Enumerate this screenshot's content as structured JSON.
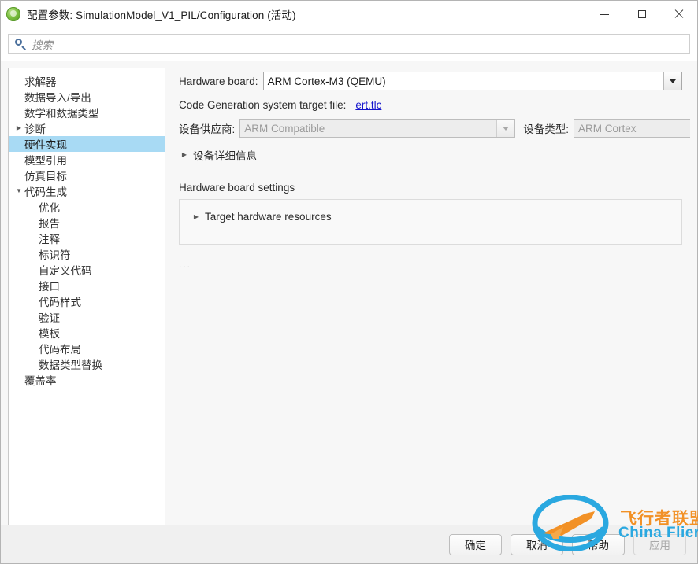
{
  "window": {
    "title": "配置参数: SimulationModel_V1_PIL/Configuration (活动)",
    "app_icon": "simulink-icon",
    "controls": {
      "minimize": "minimize-icon",
      "maximize": "maximize-icon",
      "close": "close-icon"
    }
  },
  "search": {
    "icon": "search-icon",
    "placeholder": "搜索",
    "value": ""
  },
  "sidebar": {
    "items": [
      {
        "label": "求解器",
        "level": 0,
        "twisty": "",
        "selected": false
      },
      {
        "label": "数据导入/导出",
        "level": 0,
        "twisty": "",
        "selected": false
      },
      {
        "label": "数学和数据类型",
        "level": 0,
        "twisty": "",
        "selected": false
      },
      {
        "label": "诊断",
        "level": 0,
        "twisty": "▶",
        "selected": false
      },
      {
        "label": "硬件实现",
        "level": 0,
        "twisty": "",
        "selected": true
      },
      {
        "label": "模型引用",
        "level": 0,
        "twisty": "",
        "selected": false
      },
      {
        "label": "仿真目标",
        "level": 0,
        "twisty": "",
        "selected": false
      },
      {
        "label": "代码生成",
        "level": 0,
        "twisty": "▼",
        "selected": false
      },
      {
        "label": "优化",
        "level": 1,
        "twisty": "",
        "selected": false
      },
      {
        "label": "报告",
        "level": 1,
        "twisty": "",
        "selected": false
      },
      {
        "label": "注释",
        "level": 1,
        "twisty": "",
        "selected": false
      },
      {
        "label": "标识符",
        "level": 1,
        "twisty": "",
        "selected": false
      },
      {
        "label": "自定义代码",
        "level": 1,
        "twisty": "",
        "selected": false
      },
      {
        "label": "接口",
        "level": 1,
        "twisty": "",
        "selected": false
      },
      {
        "label": "代码样式",
        "level": 1,
        "twisty": "",
        "selected": false
      },
      {
        "label": "验证",
        "level": 1,
        "twisty": "",
        "selected": false
      },
      {
        "label": "模板",
        "level": 1,
        "twisty": "",
        "selected": false
      },
      {
        "label": "代码布局",
        "level": 1,
        "twisty": "",
        "selected": false
      },
      {
        "label": "数据类型替换",
        "level": 1,
        "twisty": "",
        "selected": false
      },
      {
        "label": "覆盖率",
        "level": 0,
        "twisty": "",
        "selected": false
      }
    ]
  },
  "main": {
    "hardware_board": {
      "label": "Hardware board:",
      "value": "ARM Cortex-M3 (QEMU)",
      "enabled": true
    },
    "target_file": {
      "label": "Code Generation system target file:",
      "link": "ert.tlc"
    },
    "device_vendor": {
      "label": "设备供应商:",
      "value": "ARM Compatible",
      "enabled": false
    },
    "device_type": {
      "label": "设备类型:",
      "value": "ARM Cortex",
      "enabled": false
    },
    "device_details": {
      "label": "设备详细信息",
      "twisty": "▶",
      "expanded": false
    },
    "hardware_board_settings": {
      "label": "Hardware board settings",
      "target_hardware_resources": {
        "label": "Target hardware resources",
        "twisty": "▶",
        "expanded": false
      }
    },
    "ellipsis": "..."
  },
  "footer": {
    "ok": "确定",
    "cancel": "取消",
    "help": "帮助",
    "apply": "应用"
  },
  "watermark": {
    "logo": "airplane-ring-logo",
    "text_cn": "飞行者联盟",
    "text_en": "China Flier",
    "colors": {
      "orange": "#f29126",
      "blue": "#2aa8e0"
    }
  }
}
